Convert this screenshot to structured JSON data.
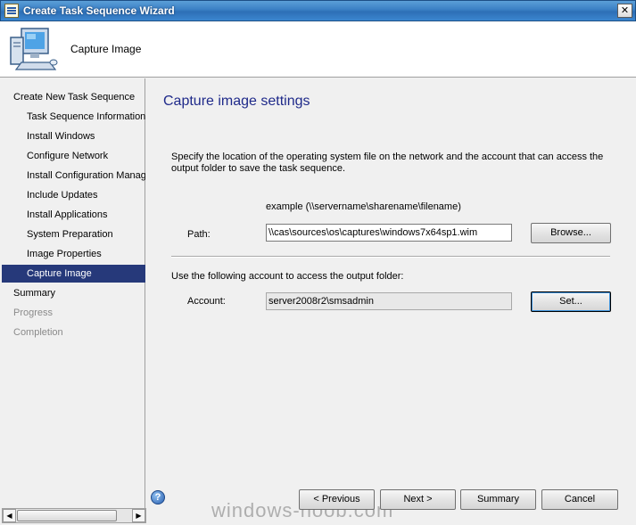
{
  "window": {
    "title": "Create Task Sequence Wizard",
    "close_glyph": "✕"
  },
  "header": {
    "heading": "Capture Image"
  },
  "nav": {
    "items": [
      {
        "label": "Create New Task Sequence",
        "level": 0,
        "state": "normal"
      },
      {
        "label": "Task Sequence Information",
        "level": 1,
        "state": "normal"
      },
      {
        "label": "Install Windows",
        "level": 1,
        "state": "normal"
      },
      {
        "label": "Configure Network",
        "level": 1,
        "state": "normal"
      },
      {
        "label": "Install Configuration Manag",
        "level": 1,
        "state": "normal"
      },
      {
        "label": "Include Updates",
        "level": 1,
        "state": "normal"
      },
      {
        "label": "Install Applications",
        "level": 1,
        "state": "normal"
      },
      {
        "label": "System Preparation",
        "level": 1,
        "state": "normal"
      },
      {
        "label": "Image Properties",
        "level": 1,
        "state": "normal"
      },
      {
        "label": "Capture Image",
        "level": 1,
        "state": "active"
      },
      {
        "label": "Summary",
        "level": 0,
        "state": "normal"
      },
      {
        "label": "Progress",
        "level": 0,
        "state": "disabled"
      },
      {
        "label": "Completion",
        "level": 0,
        "state": "disabled"
      }
    ]
  },
  "main": {
    "title": "Capture image settings",
    "description": "Specify the location of the operating system file on the network and the account that can access the output folder to save the task sequence.",
    "example": "example (\\\\servername\\sharename\\filename)",
    "path_label": "Path:",
    "path_value": "\\\\cas\\sources\\os\\captures\\windows7x64sp1.wim",
    "browse_label": "Browse...",
    "account_intro": "Use the following account to access the output folder:",
    "account_label": "Account:",
    "account_value": "server2008r2\\smsadmin",
    "set_label": "Set..."
  },
  "footer": {
    "help_glyph": "?",
    "previous_label": "< Previous",
    "next_label": "Next >",
    "summary_label": "Summary",
    "cancel_label": "Cancel",
    "watermark": "windows-noob.com"
  },
  "colors": {
    "active_nav": "#26397a",
    "title_blue": "#1f2a8a",
    "titlebar": "#3a7fc4"
  }
}
